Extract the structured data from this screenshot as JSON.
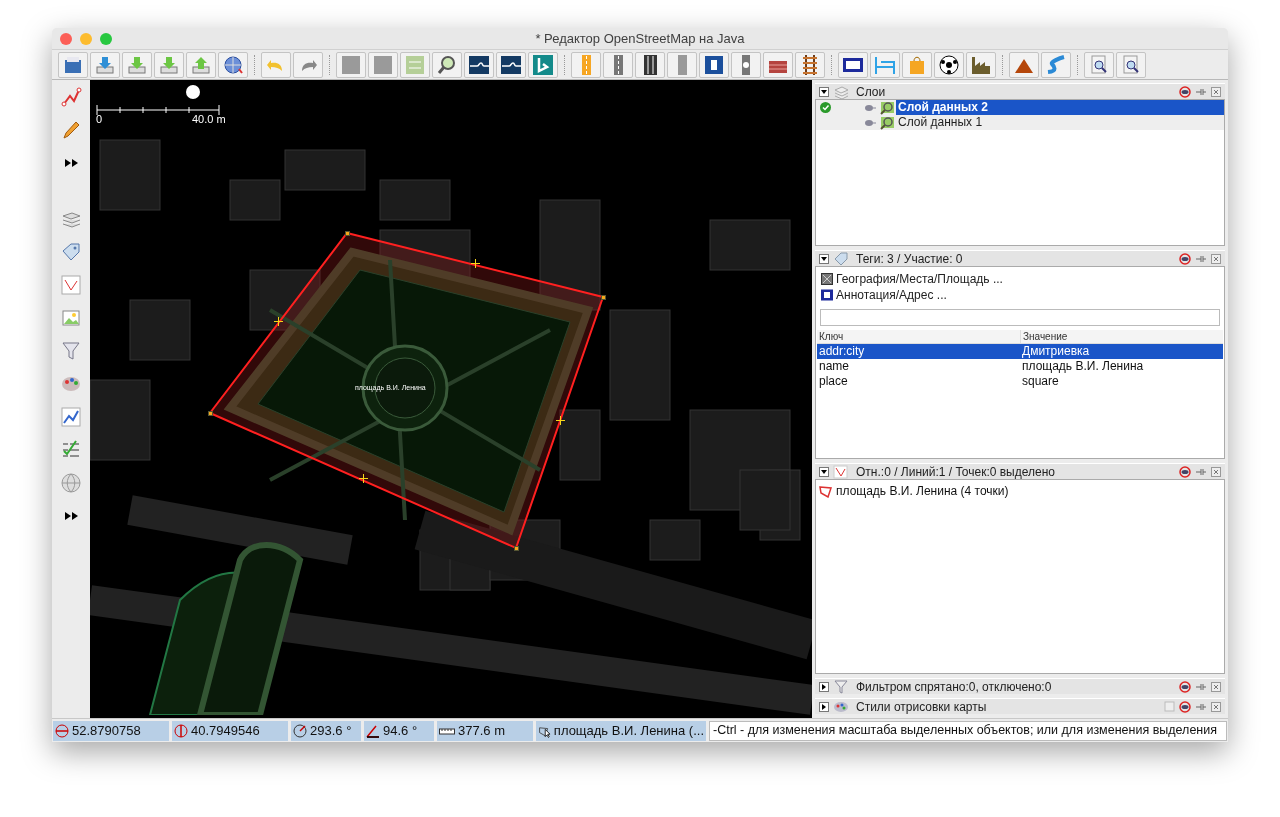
{
  "window": {
    "title": "* Редактор OpenStreetMap на Java"
  },
  "map": {
    "scale_start": "0",
    "scale_end": "40.0 m",
    "label": "площадь В.И. Ленина"
  },
  "panels": [
    {
      "kind": "layers",
      "title": "Слои",
      "expanded": true,
      "layers": [
        {
          "name": "Слой данных 2",
          "active": true,
          "selected": true
        },
        {
          "name": "Слой данных 1",
          "active": false,
          "selected": false
        }
      ]
    },
    {
      "kind": "tags",
      "title": "Теги: 3 / Участие: 0",
      "expanded": true,
      "presets": [
        "География/Места/Площадь ...",
        "Аннотация/Адрес ..."
      ],
      "columns": [
        "Ключ",
        "Значение"
      ],
      "rows": [
        {
          "key": "addr:city",
          "value": "Дмитриевка",
          "selected": true
        },
        {
          "key": "name",
          "value": "площадь В.И. Ленина",
          "selected": false
        },
        {
          "key": "place",
          "value": "square",
          "selected": false
        }
      ]
    },
    {
      "kind": "selection",
      "title": "Отн.:0 / Линий:1 / Точек:0 выделено",
      "expanded": true,
      "items": [
        "площадь В.И. Ленина (4 точки)"
      ]
    },
    {
      "kind": "filter",
      "title": "Фильтром спрятано:0, отключено:0",
      "expanded": false
    },
    {
      "kind": "styles",
      "title": "Стили отрисовки карты",
      "expanded": false
    }
  ],
  "status_bar": {
    "latitude": "52.8790758",
    "longitude": "40.7949546",
    "heading": "293.6 °",
    "angle": "94.6 °",
    "length": "377.6 m",
    "selection": "площадь В.И. Ленина (...",
    "hint": "-Ctrl - для изменения масштаба выделенных объектов; или для изменения выделения"
  }
}
